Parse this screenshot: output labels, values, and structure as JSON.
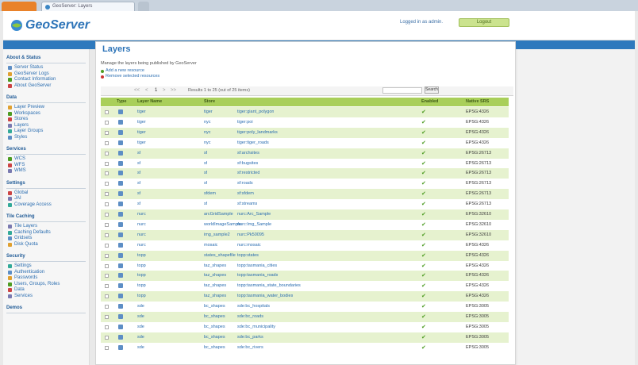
{
  "browser": {
    "active_tab_title": "GeoServer: Layers"
  },
  "header": {
    "brand": "GeoServer",
    "user_text": "Logged in as admin.",
    "logout_label": "Logout"
  },
  "sidebar": {
    "sections": [
      {
        "title": "About & Status",
        "items": [
          "Server Status",
          "GeoServer Logs",
          "Contact Information",
          "About GeoServer"
        ]
      },
      {
        "title": "Data",
        "items": [
          "Layer Preview",
          "Workspaces",
          "Stores",
          "Layers",
          "Layer Groups",
          "Styles"
        ]
      },
      {
        "title": "Services",
        "items": [
          "WCS",
          "WFS",
          "WMS"
        ]
      },
      {
        "title": "Settings",
        "items": [
          "Global",
          "JAI",
          "Coverage Access"
        ]
      },
      {
        "title": "Tile Caching",
        "items": [
          "Tile Layers",
          "Caching Defaults",
          "Gridsets",
          "Disk Quota"
        ]
      },
      {
        "title": "Security",
        "items": [
          "Settings",
          "Authentication",
          "Passwords",
          "Users, Groups, Roles",
          "Data",
          "Services"
        ]
      },
      {
        "title": "Demos",
        "items": []
      }
    ]
  },
  "main": {
    "title": "Layers",
    "description": "Manage the layers being published by GeoServer",
    "actions": [
      "Add a new resource",
      "Remove selected resources"
    ],
    "pager": {
      "nav": [
        "<<",
        "<",
        "1",
        ">",
        ">>"
      ],
      "results": "Results 1 to 25 (out of 25 items)",
      "search_button": "Search"
    },
    "table": {
      "columns": [
        "Type",
        "Layer Name",
        "Store",
        "Enabled",
        "Native SRS"
      ],
      "rows": [
        {
          "name": "tiger:giant_polygon",
          "store": "tiger",
          "workspace": "tiger"
        },
        {
          "name": "tiger:poi",
          "store": "nyc",
          "workspace": "tiger"
        },
        {
          "name": "tiger:poly_landmarks",
          "store": "nyc",
          "workspace": "tiger"
        },
        {
          "name": "tiger:tiger_roads",
          "store": "nyc",
          "workspace": "tiger"
        },
        {
          "name": "sf:archsites",
          "store": "sf",
          "workspace": "sf"
        },
        {
          "name": "sf:bugsites",
          "store": "sf",
          "workspace": "sf"
        },
        {
          "name": "sf:restricted",
          "store": "sf",
          "workspace": "sf"
        },
        {
          "name": "sf:roads",
          "store": "sf",
          "workspace": "sf"
        },
        {
          "name": "sf:sfdem",
          "store": "sfdem",
          "workspace": "sf"
        },
        {
          "name": "sf:streams",
          "store": "sf",
          "workspace": "sf"
        },
        {
          "name": "nurc:Arc_Sample",
          "store": "arcGridSample",
          "workspace": "nurc"
        },
        {
          "name": "nurc:Img_Sample",
          "store": "worldImageSample",
          "workspace": "nurc"
        },
        {
          "name": "nurc:Pk50095",
          "store": "img_sample2",
          "workspace": "nurc"
        },
        {
          "name": "nurc:mosaic",
          "store": "mosaic",
          "workspace": "nurc"
        },
        {
          "name": "topp:states",
          "store": "states_shapefile",
          "workspace": "topp"
        },
        {
          "name": "topp:tasmania_cities",
          "store": "taz_shapes",
          "workspace": "topp"
        },
        {
          "name": "topp:tasmania_roads",
          "store": "taz_shapes",
          "workspace": "topp"
        },
        {
          "name": "topp:tasmania_state_boundaries",
          "store": "taz_shapes",
          "workspace": "topp"
        },
        {
          "name": "topp:tasmania_water_bodies",
          "store": "taz_shapes",
          "workspace": "topp"
        },
        {
          "name": "sde:bc_hospitals",
          "store": "bc_shapes",
          "workspace": "sde"
        },
        {
          "name": "sde:bc_roads",
          "store": "bc_shapes",
          "workspace": "sde"
        },
        {
          "name": "sde:bc_municipality",
          "store": "bc_shapes",
          "workspace": "sde"
        },
        {
          "name": "sde:bc_parks",
          "store": "bc_shapes",
          "workspace": "sde"
        },
        {
          "name": "sde:bc_rivers",
          "store": "bc_shapes",
          "workspace": "sde"
        }
      ],
      "srs_values": [
        "EPSG:4326",
        "EPSG:4326",
        "EPSG:4326",
        "EPSG:4326",
        "EPSG:26713",
        "EPSG:26713",
        "EPSG:26713",
        "EPSG:26713",
        "EPSG:26713",
        "EPSG:26713",
        "EPSG:32610",
        "EPSG:32610",
        "EPSG:32610",
        "EPSG:4326",
        "EPSG:4326",
        "EPSG:4326",
        "EPSG:4326",
        "EPSG:4326",
        "EPSG:4326",
        "EPSG:3005",
        "EPSG:3005",
        "EPSG:3005",
        "EPSG:3005",
        "EPSG:3005"
      ]
    }
  },
  "colors": {
    "brand": "#2d74b8",
    "accent_green": "#a9cf5a",
    "row_alt": "#e6f2cf",
    "link": "#2a6db0"
  },
  "icons": {
    "logo": "globe-icon",
    "add": "add-icon",
    "remove": "remove-icon",
    "layer_type": "layer-icon",
    "enabled": "checkmark-icon"
  }
}
